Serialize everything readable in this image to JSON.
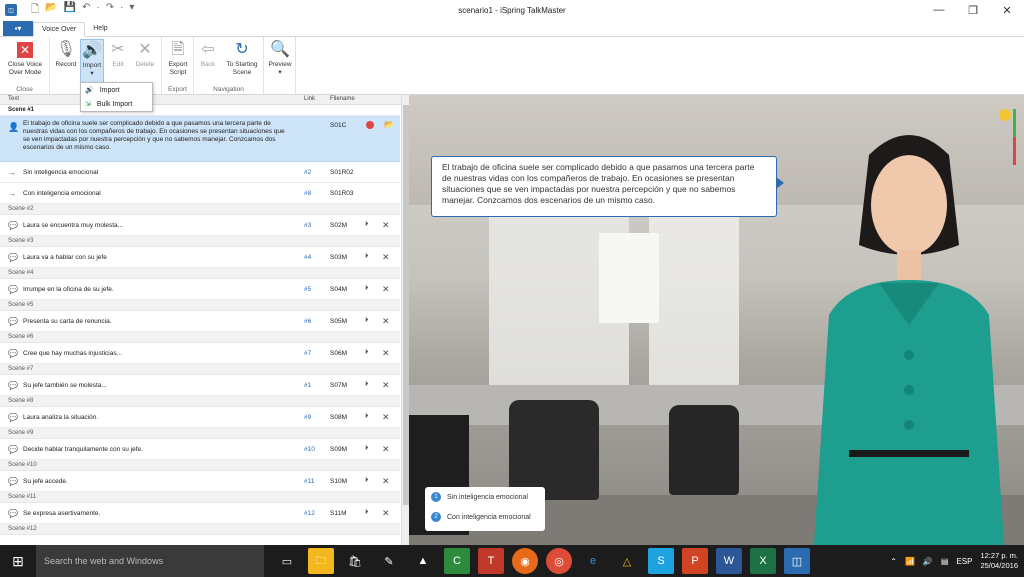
{
  "window": {
    "title": "scenario1 - iSpring TalkMaster",
    "minimize": "—",
    "restore": "❐",
    "close": "✕"
  },
  "qat": [
    "🗋",
    "📂",
    "💾",
    "↶",
    "·",
    "↷",
    "·",
    "▾"
  ],
  "tabs": {
    "file": "▪▾",
    "voice_over": "Voice Over",
    "help": "Help"
  },
  "ribbon": {
    "close_label": "Close Voice Over Mode",
    "record": "Record",
    "import": "Import",
    "edit": "Edit",
    "delete": "Delete",
    "export_script": "Export Script",
    "back": "Back",
    "to_starting_scene": "To Starting Scene",
    "preview": "Preview",
    "groups": {
      "close": "Close",
      "export": "Export",
      "navigation": "Navigation"
    }
  },
  "import_menu": {
    "import": "Import",
    "bulk_import": "Bulk Import"
  },
  "list": {
    "headers": {
      "text": "Text",
      "link": "Link",
      "filename": "Filename"
    },
    "scene1": "Scene #1",
    "main": {
      "text": "El trabajo de oficina suele ser complicado debido a que pasamos una tercera parte de nuestras vidas con los compañeros de trabajo. En ocasiones se presentan situaciones que se ven impactadas por nuestra percepción y que no sabemos manejar. Conzcamos dos escenarios de un mismo caso.",
      "file": "S01C"
    },
    "sub1": {
      "text": "Sin inteligencia emocional",
      "link": "#2",
      "file": "S01R02"
    },
    "sub2": {
      "text": "Con inteligencia emocional",
      "link": "#8",
      "file": "S01R03"
    },
    "scenes": [
      {
        "scene": "Scene #2",
        "text": "Laura se encuentra muy molesta...",
        "link": "#3",
        "file": "S02M"
      },
      {
        "scene": "Scene #3",
        "text": "Laura va a hablar con su jefe",
        "link": "#4",
        "file": "S03M"
      },
      {
        "scene": "Scene #4",
        "text": "Irrumpe en la oficina de su jefe.",
        "link": "#5",
        "file": "S04M"
      },
      {
        "scene": "Scene #5",
        "text": "Presenta su carta de renuncia.",
        "link": "#6",
        "file": "S05M"
      },
      {
        "scene": "Scene #6",
        "text": "Cree que hay muchas injusticias...",
        "link": "#7",
        "file": "S06M"
      },
      {
        "scene": "Scene #7",
        "text": "Su jefe también se molesta...",
        "link": "#1",
        "file": "S07M"
      },
      {
        "scene": "Scene #8",
        "text": "Laura analiza la situación.",
        "link": "#9",
        "file": "S08M"
      },
      {
        "scene": "Scene #9",
        "text": "Decide hablar tranquilamente con su jefe.",
        "link": "#10",
        "file": "S09M"
      },
      {
        "scene": "Scene #10",
        "text": "Su jefe accede.",
        "link": "#11",
        "file": "S10M"
      },
      {
        "scene": "Scene #11",
        "text": "Se expresa asertivamente.",
        "link": "#12",
        "file": "S11M"
      }
    ],
    "last_scene": "Scene #12"
  },
  "stage": {
    "bubble": "El trabajo de oficina suele ser complicado debido a que pasamos una tercera parte de nuestras vidas con los compañeros de trabajo. En ocasiones se presentan situaciones que se ven impactadas por nuestra percepción y que no sabemos manejar. Conzcamos dos escenarios de un mismo caso.",
    "choices": [
      {
        "num": "1",
        "label": "Sin inteligencia emocional"
      },
      {
        "num": "2",
        "label": "Con inteligencia emocional"
      }
    ]
  },
  "taskbar": {
    "search": "Search the web and Windows",
    "lang": "ESP",
    "time": "12:27 p. m.",
    "date": "25/04/2016"
  },
  "colors": {
    "accent": "#2b6cb0",
    "selected_row": "#cde3f7"
  }
}
